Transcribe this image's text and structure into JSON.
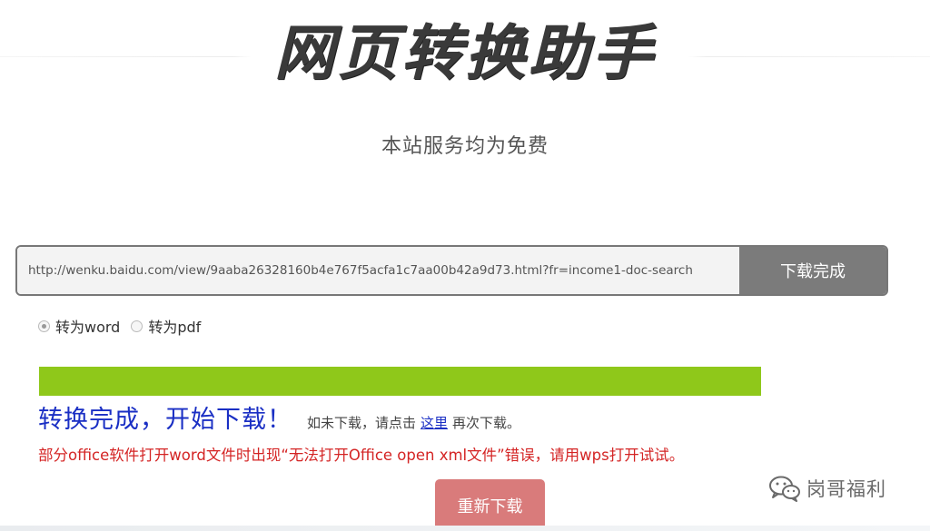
{
  "header": {
    "title": "网页转换助手",
    "subtitle": "本站服务均为免费"
  },
  "converter": {
    "url_value": "http://wenku.baidu.com/view/9aaba26328160b4e767f5acfa1c7aa00b42a9d73.html?fr=income1-doc-search",
    "button_label": "下载完成"
  },
  "options": [
    {
      "label": "转为word",
      "checked": true
    },
    {
      "label": "转为pdf",
      "checked": false
    }
  ],
  "progress": {
    "percent": 100
  },
  "status": {
    "main": "转换完成，开始下载！",
    "hint_before": "如未下载，请点击",
    "link": "这里",
    "hint_after": "再次下载。"
  },
  "warning": "部分office软件打开word文件时出现“无法打开Office open xml文件”错误，请用wps打开试试。",
  "redownload_label": "重新下载",
  "watermark": {
    "icon": "wechat-icon",
    "text": "岗哥福利"
  },
  "colors": {
    "progress": "#8fc81a",
    "status": "#1a2fc4",
    "warning": "#d42424",
    "button_gray": "#7b7b7b",
    "button_red": "#d97b7b"
  }
}
